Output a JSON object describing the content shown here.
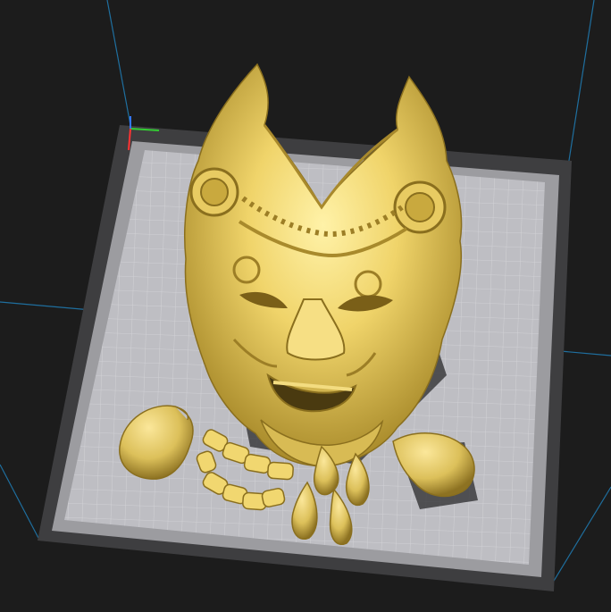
{
  "viewport": {
    "background_color": "#1c1c1c",
    "build_volume_edge_color": "#1f7fbf",
    "plate_outer_color": "#3d3d3d",
    "plate_inner_color": "#b9b9bd",
    "grid_color": "#d9d9dd",
    "model_color": "#e6c85a"
  },
  "axes": {
    "x_color": "#ff3333",
    "y_color": "#33ff33",
    "z_color": "#3377ff"
  },
  "models": [
    {
      "name": "oni-mask-main"
    },
    {
      "name": "horn-left"
    },
    {
      "name": "horn-right"
    },
    {
      "name": "teeth-strip"
    },
    {
      "name": "fang-1"
    },
    {
      "name": "fang-2"
    },
    {
      "name": "fang-3"
    },
    {
      "name": "fang-4"
    }
  ]
}
